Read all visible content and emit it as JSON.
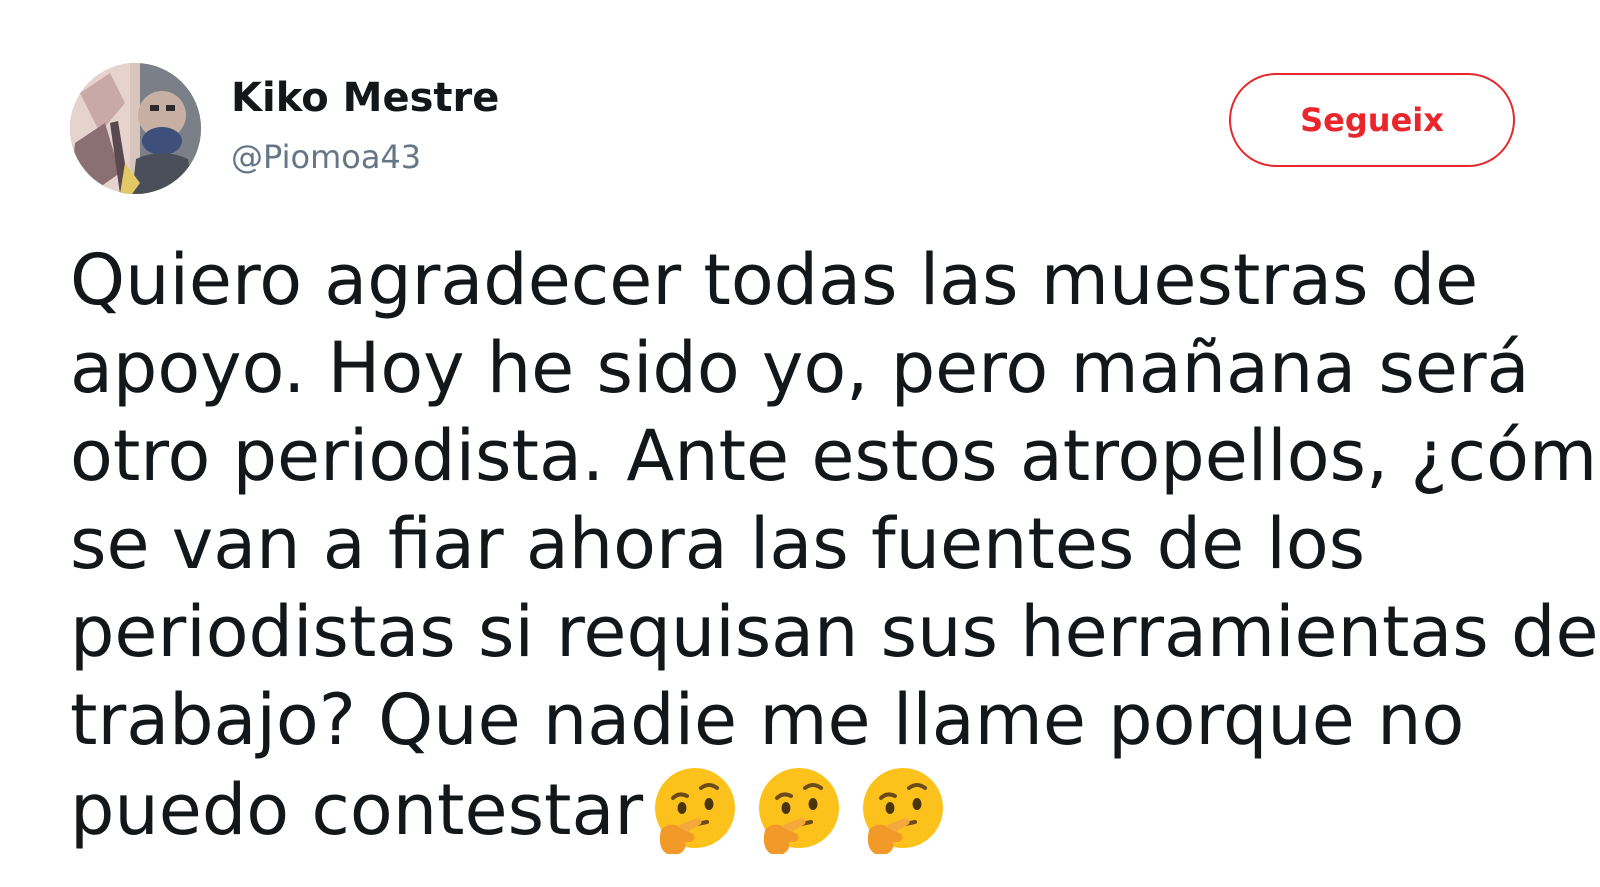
{
  "author": {
    "name": "Kiko Mestre",
    "handle": "@Piomoa43"
  },
  "follow_button": {
    "label": "Segueix"
  },
  "tweet": {
    "lines": [
      "Quiero agradecer todas las muestras de",
      "apoyo. Hoy he sido yo, pero mañana será",
      "otro periodista. Ante estos atropellos, ¿cómo",
      "se van a fiar ahora las fuentes de los",
      "periodistas si requisan sus herramientas de",
      "trabajo? Que nadie me llame porque no",
      "puedo contestar"
    ],
    "emojis": [
      "thinking-face-emoji",
      "thinking-face-emoji",
      "thinking-face-emoji"
    ]
  },
  "colors": {
    "follow_accent": "#e8262c",
    "text": "#14171a",
    "handle": "#657786"
  }
}
